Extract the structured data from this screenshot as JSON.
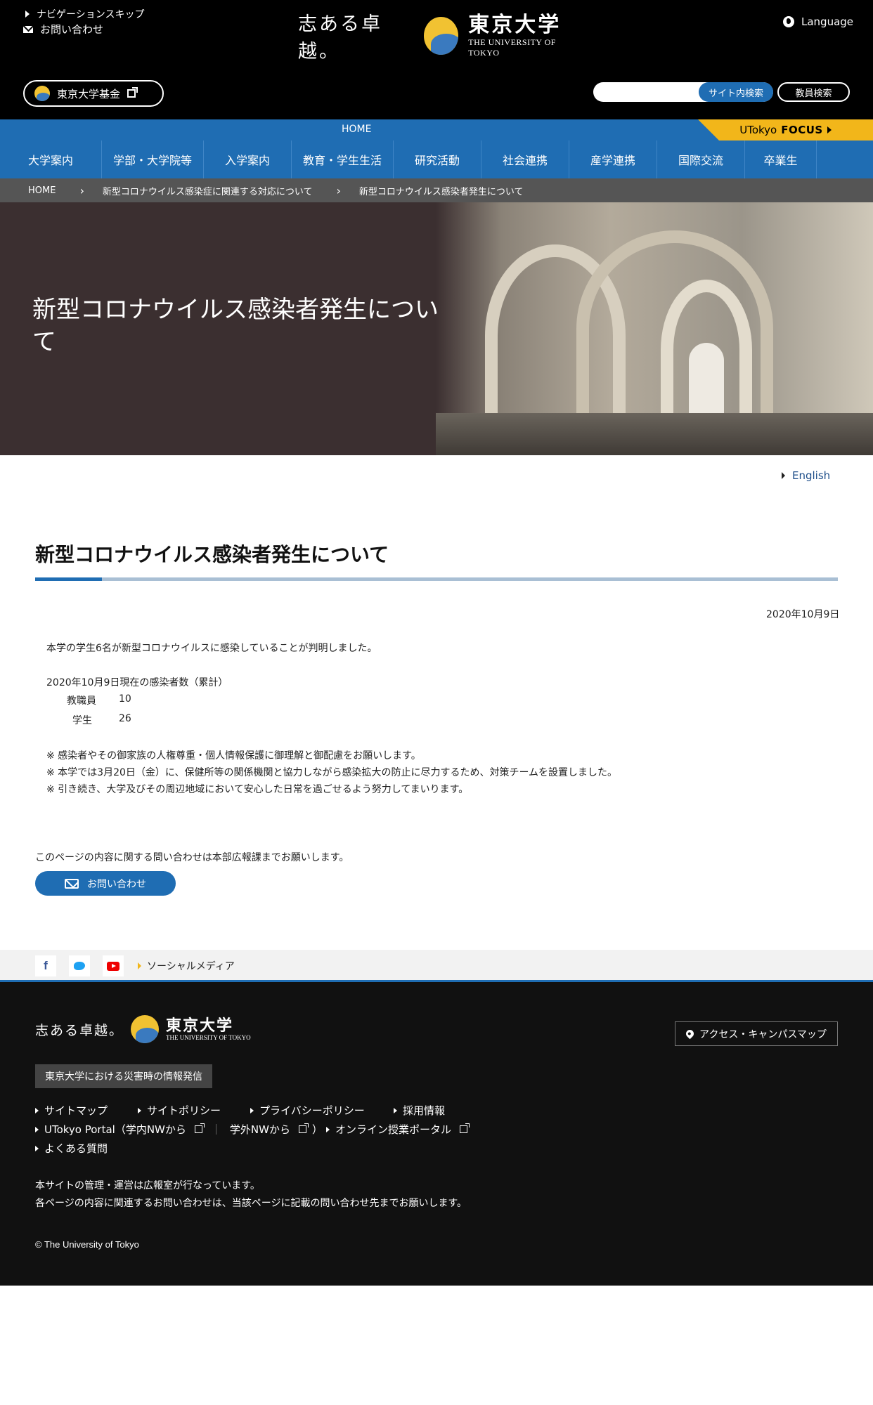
{
  "header": {
    "skip_nav": "ナビゲーションスキップ",
    "contact": "お問い合わせ",
    "logo_slogan": "志ある卓越。",
    "logo_name_jp": "東京大学",
    "logo_name_en": "THE UNIVERSITY OF TOKYO",
    "language": "Language",
    "fund": "東京大学基金",
    "site_search": "サイト内検索",
    "staff_search": "教員検索"
  },
  "nav": {
    "home": "HOME",
    "focus_prefix": "UTokyo",
    "focus_bold": "FOCUS",
    "items": [
      "大学案内",
      "学部・大学院等",
      "入学案内",
      "教育・学生生活",
      "研究活動",
      "社会連携",
      "産学連携",
      "国際交流",
      "卒業生"
    ]
  },
  "breadcrumb": [
    "HOME",
    "新型コロナウイルス感染症に関連する対応について",
    "新型コロナウイルス感染者発生について"
  ],
  "hero": {
    "title": "新型コロナウイルス感染者発生について"
  },
  "content": {
    "english_link": "English",
    "title": "新型コロナウイルス感染者発生について",
    "date": "2020年10月9日",
    "intro": "本学の学生6名が新型コロナウイルスに感染していることが判明しました。",
    "count_heading": "2020年10月9日現在の感染者数（累計）",
    "counts": [
      {
        "label": "教職員",
        "value": "10"
      },
      {
        "label": "学生",
        "value": "26"
      }
    ],
    "notes": [
      "※ 感染者やその御家族の人権尊重・個人情報保護に御理解と御配慮をお願いします。",
      "※ 本学では3月20日（金）に、保健所等の関係機関と協力しながら感染拡大の防止に尽力するため、対策チームを設置しました。",
      "※ 引き続き、大学及びその周辺地域において安心した日常を過ごせるよう努力してまいります。"
    ],
    "contact_note": "このページの内容に関する問い合わせは本部広報課までお願いします。",
    "contact_button": "お問い合わせ"
  },
  "social": {
    "label": "ソーシャルメディア",
    "facebook": "f"
  },
  "footer": {
    "access": "アクセス・キャンパスマップ",
    "disaster": "東京大学における災害時の情報発信",
    "links": {
      "sitemap": "サイトマップ",
      "policy": "サイトポリシー",
      "privacy": "プライバシーポリシー",
      "recruit": "採用情報",
      "portal_a": "UTokyo Portal（学内NWから",
      "portal_sep": "｜",
      "portal_b": "学外NWから",
      "portal_close": "）",
      "online": "オンライン授業ポータル",
      "faq": "よくある質問"
    },
    "note1": "本サイトの管理・運営は広報室が行なっています。",
    "note2": "各ページの内容に関連するお問い合わせは、当該ページに記載の問い合わせ先までお願いします。",
    "copyright": "© The University of Tokyo"
  }
}
